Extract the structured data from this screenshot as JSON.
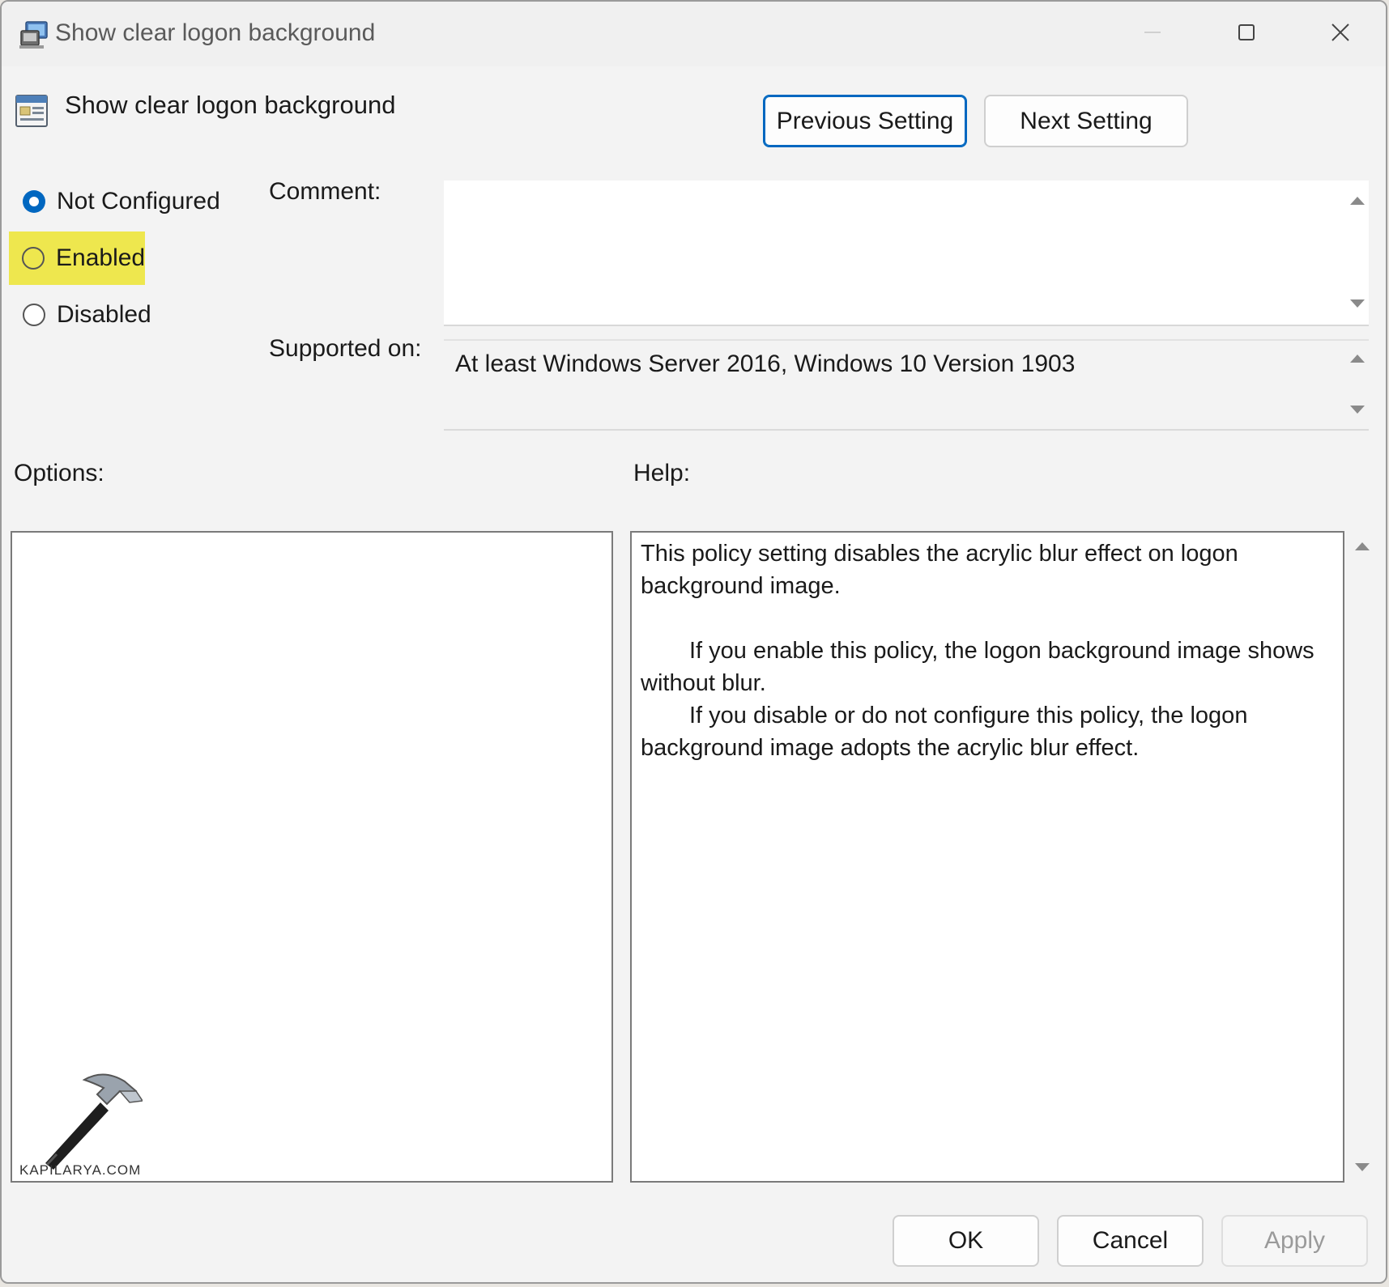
{
  "window": {
    "title": "Show clear logon background",
    "controls": {
      "minimize": "minimize",
      "maximize": "maximize",
      "close": "close"
    }
  },
  "header": {
    "policy_name": "Show clear logon background",
    "previous_label": "Previous Setting",
    "next_label": "Next Setting"
  },
  "state": {
    "options": [
      {
        "label": "Not Configured",
        "checked": true,
        "highlighted": false
      },
      {
        "label": "Enabled",
        "checked": false,
        "highlighted": true
      },
      {
        "label": "Disabled",
        "checked": false,
        "highlighted": false
      }
    ],
    "highlight_color": "#eee74e",
    "accent_color": "#0067c0"
  },
  "comment": {
    "label": "Comment:",
    "value": ""
  },
  "supported": {
    "label": "Supported on:",
    "value": "At least Windows Server 2016, Windows 10 Version 1903"
  },
  "options_panel": {
    "label": "Options:"
  },
  "help_panel": {
    "label": "Help:",
    "paragraphs": [
      "This policy setting disables the acrylic blur effect on logon background image.",
      "If you enable this policy, the logon background image shows without blur.",
      "If you disable or do not configure this policy, the logon background image adopts the acrylic blur effect."
    ]
  },
  "footer": {
    "ok_label": "OK",
    "cancel_label": "Cancel",
    "apply_label": "Apply",
    "apply_enabled": false
  },
  "watermark": {
    "text": "KAPILARYA.COM"
  }
}
